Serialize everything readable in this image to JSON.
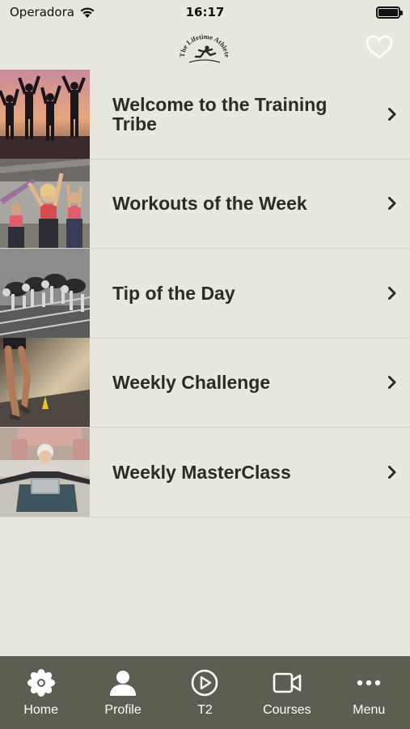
{
  "status_bar": {
    "carrier": "Operadora",
    "time": "16:17"
  },
  "header": {
    "logo_text": "The Lifetime Athlete"
  },
  "list": {
    "items": [
      {
        "label": "Welcome to the Training Tribe",
        "image": "silhouettes-sunset-celebrating"
      },
      {
        "label": "Workouts of the Week",
        "image": "women-resistance-band-workout"
      },
      {
        "label": "Tip of the Day",
        "image": "sprinters-starting-blocks"
      },
      {
        "label": "Weekly Challenge",
        "image": "runner-legs-track"
      },
      {
        "label": "Weekly MasterClass",
        "image": "senior-woman-laptop-yoga-mat"
      }
    ]
  },
  "tab_bar": {
    "tabs": [
      {
        "label": "Home",
        "icon": "flower-icon"
      },
      {
        "label": "Profile",
        "icon": "person-icon"
      },
      {
        "label": "T2",
        "icon": "play-circle-icon"
      },
      {
        "label": "Courses",
        "icon": "video-camera-icon"
      },
      {
        "label": "Menu",
        "icon": "more-dots-icon"
      }
    ]
  },
  "colors": {
    "background": "#e9e8df",
    "tab_bar": "#5e5d52",
    "text": "#2c2c26",
    "divider": "#d6d5cb"
  }
}
